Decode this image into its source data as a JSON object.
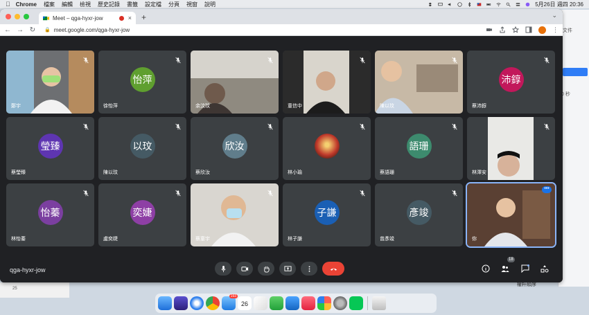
{
  "menubar": {
    "app_name": "Chrome",
    "menus": [
      "檔案",
      "編輯",
      "檢視",
      "歷史記錄",
      "書籤",
      "設定檔",
      "分頁",
      "視窗",
      "說明"
    ],
    "datetime": "5月26日 週四  20:36"
  },
  "browser": {
    "tab_title": "Meet – qga-hyxr-jow",
    "url": "meet.google.com/qga-hyxr-jow"
  },
  "background_window": {
    "label_top": "文件",
    "label_seconds": "0 秒",
    "bottom_button": "權杆順序",
    "left_strip_number": "25"
  },
  "meet": {
    "meeting_code": "qga-hyxr-jow",
    "participant_count": "18",
    "participants": [
      {
        "name": "鄭宇",
        "kind": "video",
        "scene": "boy"
      },
      {
        "name": "徐怡萍",
        "kind": "avatar",
        "initials": "怡萍",
        "color": "#5f9f2f"
      },
      {
        "name": "余汶玟",
        "kind": "video",
        "scene": "girl-dim"
      },
      {
        "name": "童信中",
        "kind": "video",
        "scene": "boy-dark"
      },
      {
        "name": "陳以玟",
        "kind": "video",
        "scene": "girl-room"
      },
      {
        "name": "蔡沛錞",
        "kind": "avatar",
        "initials": "沛錞",
        "color": "#c2185b"
      },
      {
        "name": "蔡瑩臻",
        "kind": "avatar",
        "initials": "瑩臻",
        "color": "#5e35b1"
      },
      {
        "name": "陳以玟",
        "kind": "avatar",
        "initials": "以玟",
        "color": "#455a64"
      },
      {
        "name": "蔡欣汝",
        "kind": "avatar",
        "initials": "欣汝",
        "color": "#607d8b"
      },
      {
        "name": "林小瑜",
        "kind": "photo",
        "initials": ""
      },
      {
        "name": "蔡語珊",
        "kind": "avatar",
        "initials": "語珊",
        "color": "#3d8b6e"
      },
      {
        "name": "林澤安",
        "kind": "video",
        "scene": "boy-light"
      },
      {
        "name": "林怡蓁",
        "kind": "avatar",
        "initials": "怡蓁",
        "color": "#7b3fa0"
      },
      {
        "name": "盧奕婕",
        "kind": "avatar",
        "initials": "奕婕",
        "color": "#8e3fa5"
      },
      {
        "name": "蔡童宇",
        "kind": "video",
        "scene": "boy-mask"
      },
      {
        "name": "林子謙",
        "kind": "avatar",
        "initials": "子謙",
        "color": "#1a5fb4"
      },
      {
        "name": "曾彥竣",
        "kind": "avatar",
        "initials": "彥竣",
        "color": "#455a64"
      },
      {
        "name": "你",
        "kind": "video",
        "scene": "self"
      }
    ]
  },
  "dock": {
    "mail_badge": "193",
    "calendar_day": "26"
  },
  "colors": {
    "meet_bg": "#202124",
    "tile_bg": "#3c4043",
    "end_call": "#ea4335",
    "accent": "#8ab4f8"
  }
}
